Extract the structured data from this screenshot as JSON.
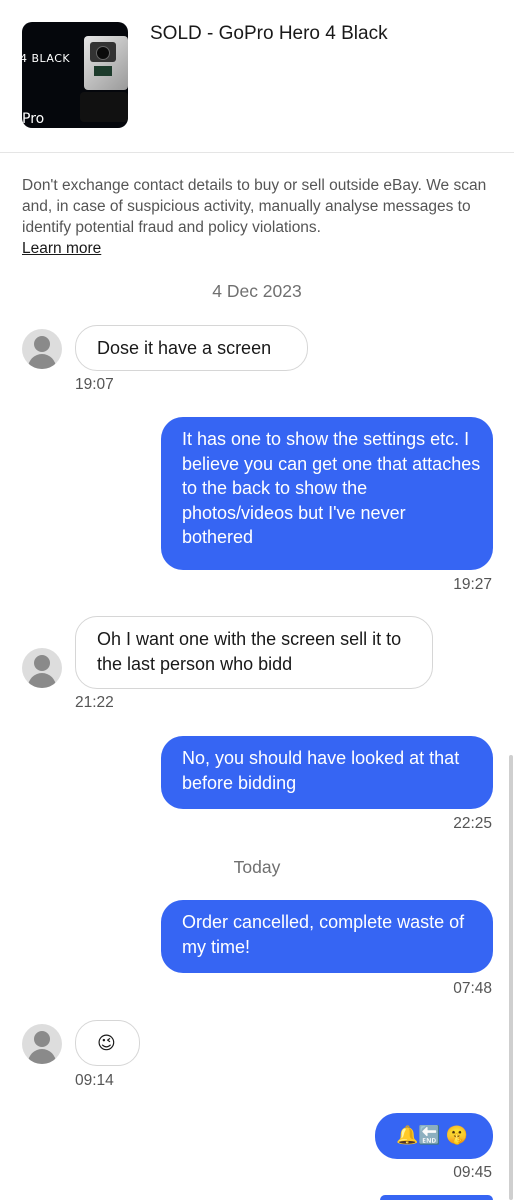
{
  "listing": {
    "title": "SOLD - GoPro Hero 4 Black",
    "thumb_brand": "4 BLACK",
    "thumb_logo": "Pro"
  },
  "notice": {
    "text": "Don't exchange contact details to buy or sell outside eBay. We scan and, in case of suspicious activity, manually analyse messages to identify potential fraud and policy violations.",
    "link": "Learn more"
  },
  "dates": {
    "first": "4 Dec 2023",
    "today": "Today"
  },
  "messages": [
    {
      "from": "buyer",
      "text": "Dose it have a screen",
      "time": "19:07"
    },
    {
      "from": "seller",
      "text": "It has one to show the settings etc. I believe you can get one that attaches to the back to show the photos/videos but I've never bothered",
      "time": "19:27"
    },
    {
      "from": "buyer",
      "text": "Oh I want one with the screen sell it to the last person who bidd",
      "time": "21:22"
    },
    {
      "from": "seller",
      "text": "No, you should have looked at that before bidding",
      "time": "22:25"
    },
    {
      "from": "seller",
      "text": "Order cancelled, complete waste of my time!",
      "time": "07:48"
    },
    {
      "from": "buyer",
      "text": "😉",
      "time": "09:14"
    },
    {
      "from": "seller",
      "text": "🔔🔚 🤫",
      "time": "09:45"
    }
  ],
  "colors": {
    "accent": "#3665f3",
    "bubble_out_text": "#ffffff",
    "muted": "#707070"
  },
  "icons": {
    "avatar": "default-user-avatar-icon"
  }
}
